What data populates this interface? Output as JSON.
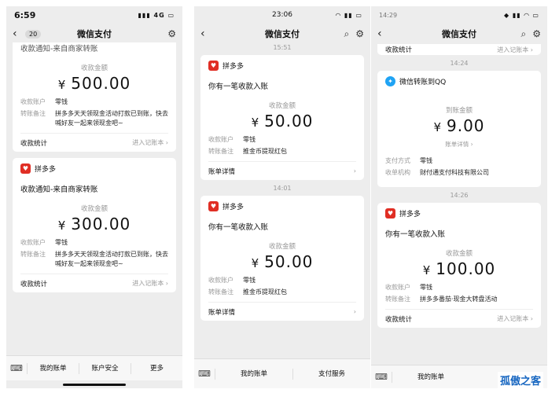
{
  "phone1": {
    "status": {
      "time": "6:59",
      "signal": "4G"
    },
    "nav": {
      "badge": "20",
      "title": "微信支付"
    },
    "card_top": {
      "title": "收款通知-来自商家转账",
      "amount_label": "收款金额",
      "currency": "¥",
      "amount": "500.00",
      "rows": [
        {
          "k": "收款账户",
          "v": "零钱"
        },
        {
          "k": "转账备注",
          "v": "拼多多天天领现金活动打款已到账，快去喊好友一起来领现金吧~"
        }
      ],
      "foot_left": "收款统计",
      "foot_right": "进入记账本"
    },
    "card2": {
      "merchant": "拼多多",
      "title": "收款通知-来自商家转账",
      "amount_label": "收款金额",
      "currency": "¥",
      "amount": "300.00",
      "rows": [
        {
          "k": "收款账户",
          "v": "零钱"
        },
        {
          "k": "转账备注",
          "v": "拼多多天天领现金活动打款已到账，快去喊好友一起来领现金吧~"
        }
      ],
      "foot_left": "收款统计",
      "foot_right": "进入记账本"
    },
    "bottom": {
      "items": [
        "我的账单",
        "账户安全",
        "更多"
      ]
    }
  },
  "phone2": {
    "status": {
      "time": "23:06"
    },
    "nav": {
      "title": "微信支付"
    },
    "time1": "15:51",
    "card1": {
      "merchant": "拼多多",
      "title": "你有一笔收款入账",
      "amount_label": "收款金额",
      "currency": "¥",
      "amount": "50.00",
      "rows": [
        {
          "k": "收款账户",
          "v": "零钱"
        },
        {
          "k": "转账备注",
          "v": "推金币提现红包"
        }
      ],
      "foot_left": "账单详情"
    },
    "time2": "14:01",
    "card2": {
      "merchant": "拼多多",
      "title": "你有一笔收款入账",
      "amount_label": "收款金额",
      "currency": "¥",
      "amount": "50.00",
      "rows": [
        {
          "k": "收款账户",
          "v": "零钱"
        },
        {
          "k": "转账备注",
          "v": "推金币提现红包"
        }
      ],
      "foot_left": "账单详情"
    },
    "bottom": {
      "items": [
        "我的账单",
        "支付服务"
      ]
    }
  },
  "phone3": {
    "status": {
      "time": "14:29"
    },
    "nav": {
      "title": "微信支付"
    },
    "top_partial": {
      "left": "收款统计",
      "right": "进入记账本"
    },
    "time1": "14:24",
    "card1": {
      "merchant": "微信转账到QQ",
      "amount_label": "到账金额",
      "currency": "¥",
      "amount": "9.00",
      "detail": "账单详情",
      "rows": [
        {
          "k": "支付方式",
          "v": "零钱"
        },
        {
          "k": "收单机构",
          "v": "财付通支付科技有限公司"
        }
      ]
    },
    "time2": "14:26",
    "card2": {
      "merchant": "拼多多",
      "title": "你有一笔收款入账",
      "amount_label": "收款金额",
      "currency": "¥",
      "amount": "100.00",
      "rows": [
        {
          "k": "收款账户",
          "v": "零钱"
        },
        {
          "k": "转账备注",
          "v": "拼多多番茄·现金大转盘活动"
        }
      ],
      "foot_left": "收款统计",
      "foot_right": "进入记账本"
    },
    "bottom": {
      "items": [
        "我的账单"
      ]
    }
  },
  "watermark": "孤傲之客"
}
